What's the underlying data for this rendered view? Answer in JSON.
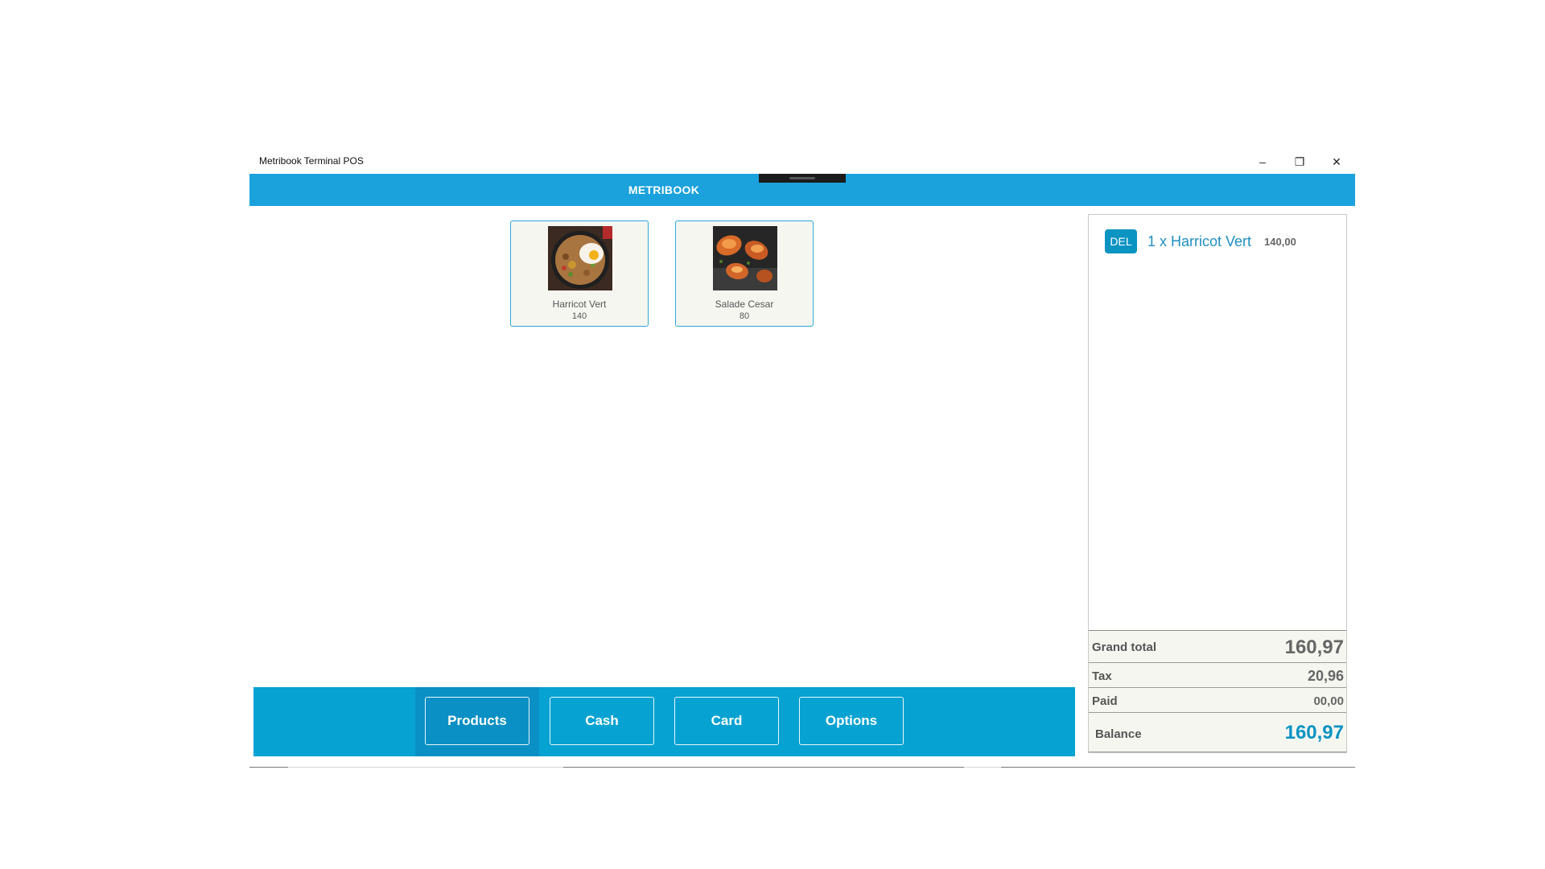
{
  "window": {
    "title": "Metribook Terminal POS",
    "minimize_label": "–",
    "maximize_label": "❐",
    "close_label": "✕"
  },
  "header": {
    "brand": "METRIBOOK",
    "accent_color": "#1ba1dc"
  },
  "products": [
    {
      "name": "Harricot Vert",
      "price": "140",
      "image_icon": "fried-rice-egg-photo"
    },
    {
      "name": "Salade Cesar",
      "price": "80",
      "image_icon": "grilled-shrimp-photo"
    }
  ],
  "actions": {
    "products_label": "Products",
    "cash_label": "Cash",
    "card_label": "Card",
    "options_label": "Options",
    "active": "Products"
  },
  "order": {
    "items": [
      {
        "del_label": "DEL",
        "description": "1 x Harricot Vert",
        "amount": "140,00"
      }
    ]
  },
  "totals": {
    "grand_total_label": "Grand total",
    "grand_total_value": "160,97",
    "tax_label": "Tax",
    "tax_value": "20,96",
    "paid_label": "Paid",
    "paid_value": "00,00",
    "balance_label": "Balance",
    "balance_value": "160,97",
    "balance_color": "#0b93c2"
  }
}
